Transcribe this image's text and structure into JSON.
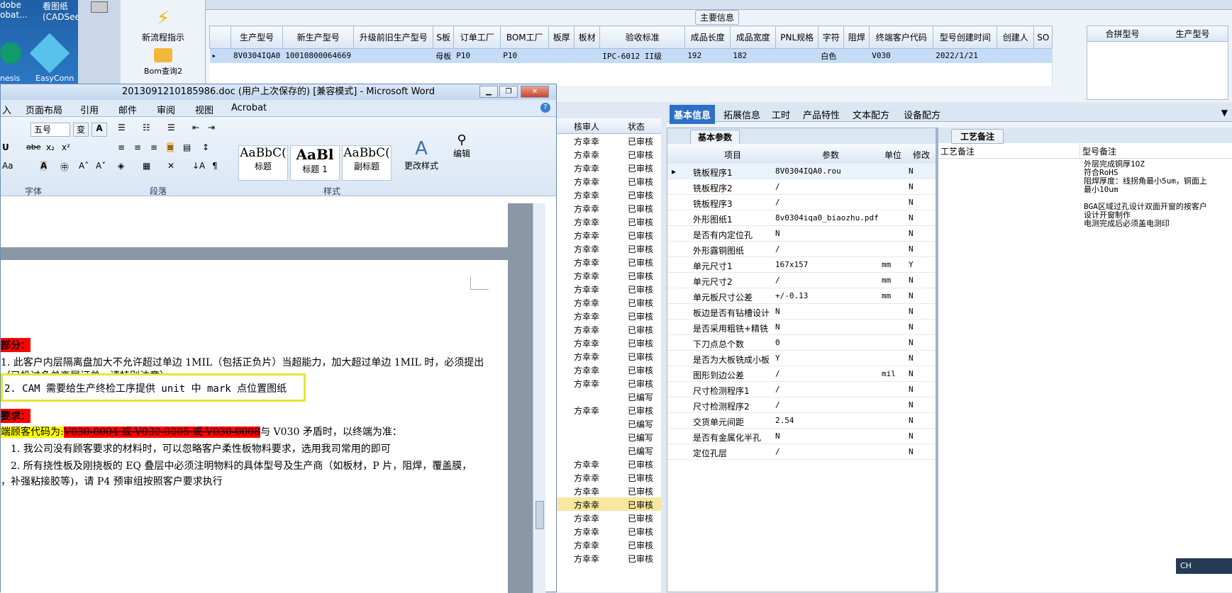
{
  "desktop": {
    "icons": [
      {
        "label": "dobe\nobat..."
      },
      {
        "label": "看图纸\n(CADSee..."
      },
      {
        "label": "nesis"
      },
      {
        "label": "EasyConn"
      }
    ]
  },
  "toolpanel": {
    "items": [
      {
        "label": "新流程指示"
      },
      {
        "label": "Bom查询2"
      }
    ]
  },
  "main_section": {
    "title": "主要信息",
    "columns": [
      "生产型号",
      "新生产型号",
      "升级前旧生产型号",
      "S板",
      "订单工厂",
      "BOM工厂",
      "板厚",
      "板材",
      "验收标准",
      "成品长度",
      "成品宽度",
      "PNL规格",
      "字符",
      "阻焊",
      "终端客户代码",
      "型号创建时间",
      "创建人",
      "SO"
    ],
    "row": [
      "8V0304IQA0",
      "10010800064669",
      "",
      "母板",
      "P10",
      "P10",
      "",
      "",
      "IPC-6012 II级",
      "192",
      "182",
      "",
      "白色",
      "",
      "V030",
      "",
      "2022/1/21",
      "",
      ""
    ],
    "side_columns": [
      "合拼型号",
      "生产型号"
    ]
  },
  "word": {
    "title": "2013091210185986.doc (用户上次保存的) [兼容模式] - Microsoft Word",
    "tabs": [
      "入",
      "页面布局",
      "引用",
      "邮件",
      "审阅",
      "视图",
      "Acrobat"
    ],
    "font_size": "五号",
    "groups": {
      "font": "字体",
      "paragraph": "段落",
      "styles": "样式"
    },
    "styles": [
      {
        "preview": "AaBbC(",
        "name": "标题"
      },
      {
        "preview": "AaBl",
        "name": "标题 1"
      },
      {
        "preview": "AaBbC(",
        "name": "副标题"
      }
    ],
    "change_style": "更改样式",
    "edit": "编辑",
    "doc": {
      "h1": "部分：",
      "p1a": "1. 此客户内层隔离盘加大不允许超过单边 1MIL（包括正负片）当超能力，加大超过单边 1MIL 时，必须提出",
      "p1b": "（已投过多单高层订单，请特别注意）",
      "p2": "2. CAM 需要给生产终检工序提供 unit 中 mark 点位置图纸",
      "h2": "要求：",
      "p3_a": "端顾客代码为:",
      "p3_b": "V030-0004 或 V030-0005 或 V030-0008",
      "p3_c": "与 V030 矛盾时，以终端为准：",
      "p4": "1.  我公司没有顾客要求的材料时，可以忽略客户柔性板物料要求，选用我司常用的即可",
      "p5": "2.  所有挠性板及刚挠板的 EQ 叠层中必须注明物料的具体型号及生产商（如板材，P 片，阻焊，覆盖膜，",
      "p6": "，补强粘接胶等)，请 P4 预审组按照客户要求执行"
    }
  },
  "approval": {
    "headers": [
      "核审人",
      "状态"
    ],
    "rows": [
      [
        "方幸幸",
        "已审核"
      ],
      [
        "方幸幸",
        "已审核"
      ],
      [
        "方幸幸",
        "已审核"
      ],
      [
        "方幸幸",
        "已审核"
      ],
      [
        "方幸幸",
        "已审核"
      ],
      [
        "方幸幸",
        "已审核"
      ],
      [
        "方幸幸",
        "已审核"
      ],
      [
        "方幸幸",
        "已审核"
      ],
      [
        "方幸幸",
        "已审核"
      ],
      [
        "方幸幸",
        "已审核"
      ],
      [
        "方幸幸",
        "已审核"
      ],
      [
        "方幸幸",
        "已审核"
      ],
      [
        "方幸幸",
        "已审核"
      ],
      [
        "方幸幸",
        "已审核"
      ],
      [
        "方幸幸",
        "已审核"
      ],
      [
        "方幸幸",
        "已审核"
      ],
      [
        "方幸幸",
        "已审核"
      ],
      [
        "方幸幸",
        "已审核"
      ],
      [
        "方幸幸",
        "已审核"
      ],
      [
        "",
        "已编写"
      ],
      [
        "方幸幸",
        "已审核"
      ],
      [
        "",
        "已编写"
      ],
      [
        "",
        "已编写"
      ],
      [
        "",
        "已编写"
      ],
      [
        "方幸幸",
        "已审核"
      ],
      [
        "方幸幸",
        "已审核"
      ],
      [
        "方幸幸",
        "已审核"
      ],
      [
        "方幸幸",
        "已审核"
      ],
      [
        "方幸幸",
        "已审核"
      ],
      [
        "方幸幸",
        "已审核"
      ],
      [
        "方幸幸",
        "已审核"
      ],
      [
        "方幸幸",
        "已审核"
      ]
    ]
  },
  "right_tabs": [
    "基本信息",
    "拓展信息",
    "工时",
    "产品特性",
    "文本配方",
    "设备配方"
  ],
  "params": {
    "title": "基本参数",
    "headers": [
      "项目",
      "参数",
      "单位",
      "修改"
    ],
    "rows": [
      [
        "铣板程序1",
        "8V0304IQA0.rou",
        "",
        "N"
      ],
      [
        "铣板程序2",
        "/",
        "",
        "N"
      ],
      [
        "铣板程序3",
        "/",
        "",
        "N"
      ],
      [
        "外形图纸1",
        "8v0304iqa0_biaozhu.pdf",
        "",
        "N"
      ],
      [
        "是否有内定位孔",
        "N",
        "",
        "N"
      ],
      [
        "外形露铜图纸",
        "/",
        "",
        "N"
      ],
      [
        "单元尺寸1",
        "167x157",
        "mm",
        "Y"
      ],
      [
        "单元尺寸2",
        "/",
        "mm",
        "N"
      ],
      [
        "单元板尺寸公差",
        "+/-0.13",
        "mm",
        "N"
      ],
      [
        "板边是否有钻槽设计",
        "N",
        "",
        "N"
      ],
      [
        "是否采用粗铣+精铣",
        "N",
        "",
        "N"
      ],
      [
        "下刀点总个数",
        "0",
        "",
        "N"
      ],
      [
        "是否为大板铣成小板",
        "Y",
        "",
        "N"
      ],
      [
        "图形到边公差",
        "/",
        "mil",
        "N"
      ],
      [
        "尺寸检测程序1",
        "/",
        "",
        "N"
      ],
      [
        "尺寸检测程序2",
        "/",
        "",
        "N"
      ],
      [
        "交货单元间距",
        "2.54",
        "",
        "N"
      ],
      [
        "是否有金属化半孔",
        "N",
        "",
        "N"
      ],
      [
        "定位孔层",
        "/",
        "",
        "N"
      ]
    ]
  },
  "notes": {
    "tab": "工艺备注",
    "headers": [
      "工艺备注",
      "型号备注"
    ],
    "lines": [
      "外层完成铜厚1OZ",
      "符合RoHS",
      "阻焊厚度：线拐角最小5um，铜面上",
      "最小10um",
      "",
      "BGA区域过孔设计双面开窗的按客户",
      "设计开窗制作",
      "电测完成后必须盖电测印"
    ]
  },
  "ime": {
    "label": "CH"
  }
}
